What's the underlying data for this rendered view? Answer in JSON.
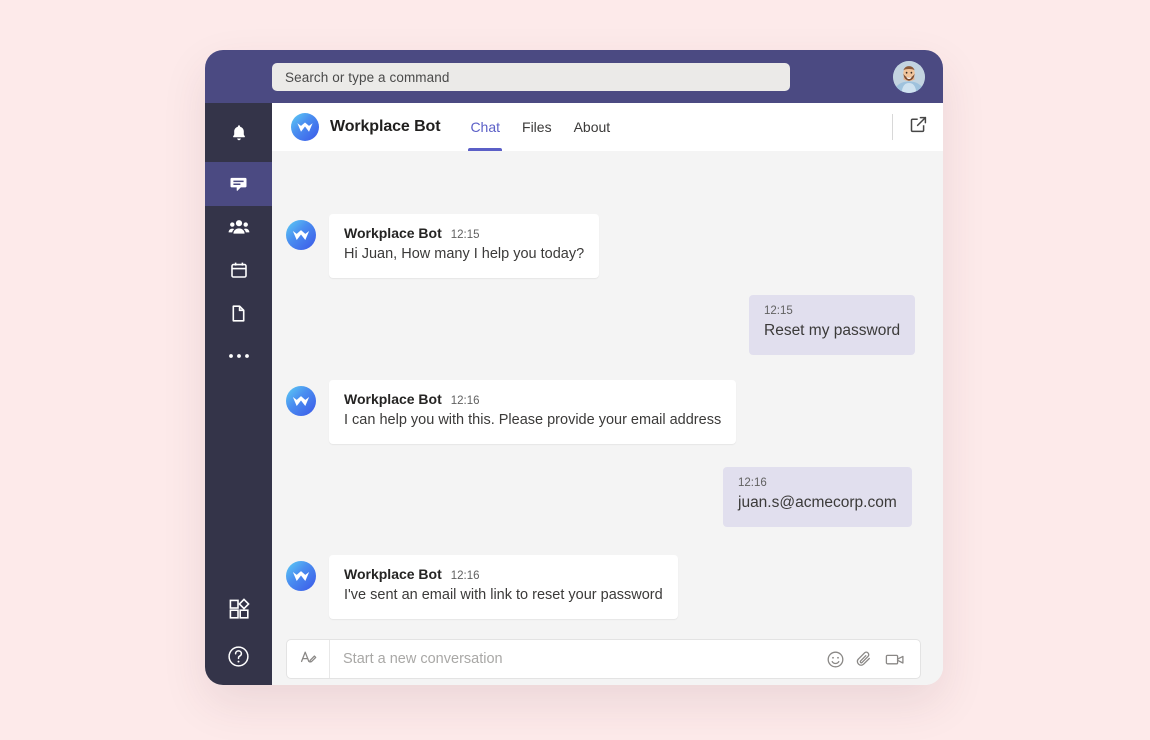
{
  "theme": {
    "page_background": "#fdeaea",
    "topbar_color": "#4b4a82",
    "rail_color": "#343449",
    "accent_color": "#5b5fc7",
    "bot_bubble_color": "#ffffff",
    "user_bubble_color": "#e1dfee",
    "conversation_background": "#f4f4f4"
  },
  "topbar": {
    "search": {
      "placeholder": "Search or type a command",
      "value": ""
    },
    "avatar_name": "user-avatar"
  },
  "rail": {
    "items": [
      {
        "icon": "bell-icon",
        "label": "Activity",
        "active": false
      },
      {
        "icon": "chat-icon",
        "label": "Chat",
        "active": true
      },
      {
        "icon": "people-icon",
        "label": "Teams",
        "active": false
      },
      {
        "icon": "calendar-icon",
        "label": "Calendar",
        "active": false
      },
      {
        "icon": "files-icon",
        "label": "Files",
        "active": false
      },
      {
        "icon": "more-icon",
        "label": "More",
        "active": false
      }
    ],
    "bottom_items": [
      {
        "icon": "apps-icon",
        "label": "Apps"
      },
      {
        "icon": "help-icon",
        "label": "Help"
      }
    ]
  },
  "channel": {
    "title": "Workplace Bot",
    "logo": "workplace-bot-logo",
    "tabs": [
      {
        "label": "Chat",
        "active": true
      },
      {
        "label": "Files",
        "active": false
      },
      {
        "label": "About",
        "active": false
      }
    ],
    "popout_icon": "open-in-new-window-icon"
  },
  "conversation": {
    "messages": [
      {
        "side": "bot",
        "sender": "Workplace Bot",
        "time": "12:15",
        "text": "Hi Juan, How many I help you today?"
      },
      {
        "side": "user",
        "sender": "",
        "time": "12:15",
        "text": "Reset my password"
      },
      {
        "side": "bot",
        "sender": "Workplace Bot",
        "time": "12:16",
        "text": "I can help you with this. Please provide your email address"
      },
      {
        "side": "user",
        "sender": "",
        "time": "12:16",
        "text": "juan.s@acmecorp.com"
      },
      {
        "side": "bot",
        "sender": "Workplace Bot",
        "time": "12:16",
        "text": "I've sent an email with link to reset your password"
      }
    ]
  },
  "composer": {
    "format_icon": "format-text-icon",
    "placeholder": "Start a new conversation",
    "value": "",
    "actions": [
      {
        "icon": "emoji-icon",
        "label": "Emoji"
      },
      {
        "icon": "attachment-icon",
        "label": "Attach"
      },
      {
        "icon": "video-icon",
        "label": "Video"
      }
    ]
  }
}
